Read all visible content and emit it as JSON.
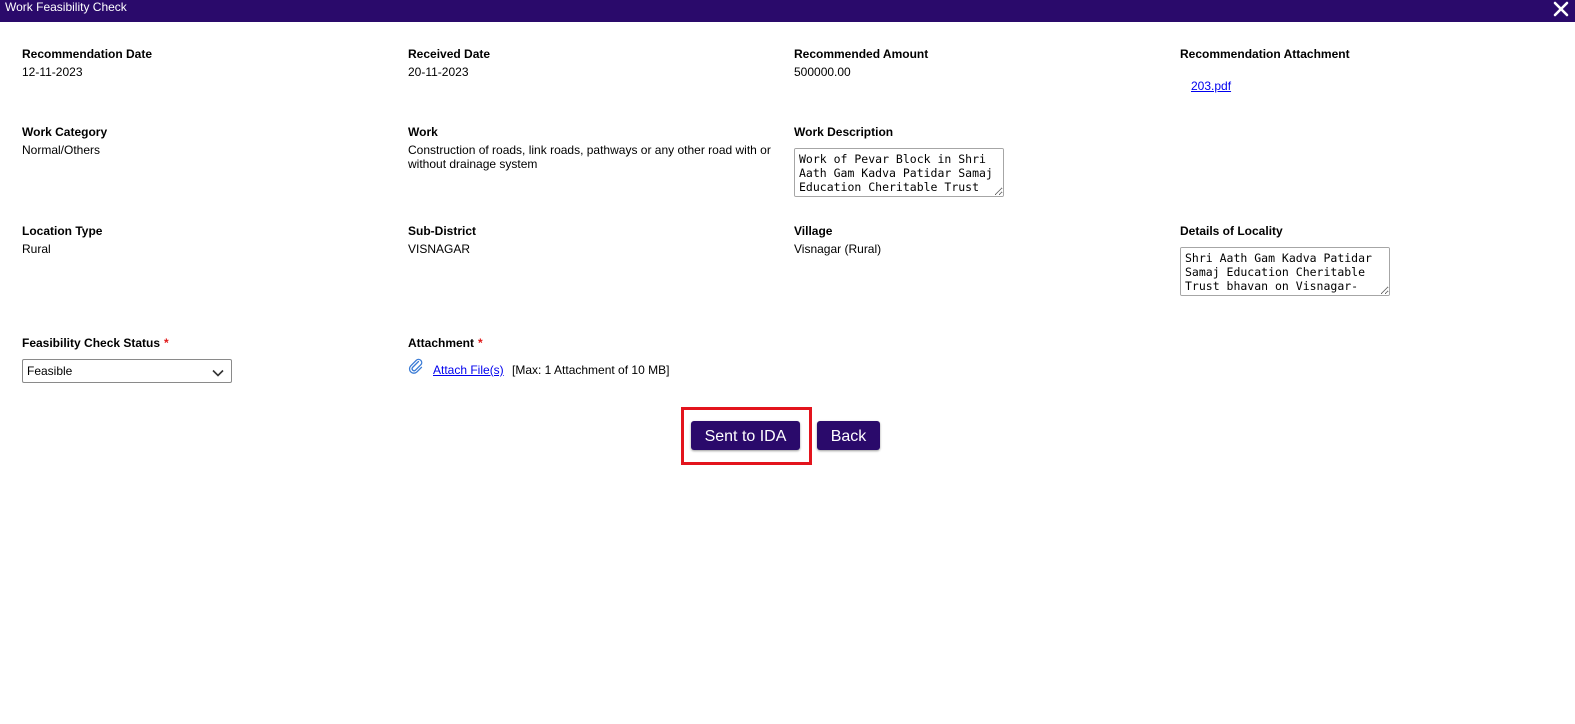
{
  "window": {
    "title": "Work Feasibility Check",
    "close_icon": "close-icon",
    "titlebar_color": "#2a0a6b"
  },
  "fields": {
    "recommendation_date": {
      "label": "Recommendation Date",
      "value": "12-11-2023"
    },
    "received_date": {
      "label": "Received Date",
      "value": "20-11-2023"
    },
    "recommended_amount": {
      "label": "Recommended Amount",
      "value": "500000.00"
    },
    "recommendation_attachment": {
      "label": "Recommendation Attachment",
      "link": "203.pdf"
    },
    "work_category": {
      "label": "Work Category",
      "value": "Normal/Others"
    },
    "work": {
      "label": "Work",
      "value": "Construction of roads, link roads, pathways or any other road with or without drainage system"
    },
    "work_description": {
      "label": "Work Description",
      "value": "Work of Pevar Block in Shri Aath Gam Kadva Patidar Samaj Education Cheritable Trust"
    },
    "location_type": {
      "label": "Location Type",
      "value": "Rural"
    },
    "sub_district": {
      "label": "Sub-District",
      "value": "VISNAGAR"
    },
    "village": {
      "label": "Village",
      "value": "Visnagar (Rural)"
    },
    "details_of_locality": {
      "label": "Details of Locality",
      "value": "Shri Aath Gam Kadva Patidar Samaj Education Cheritable Trust bhavan on Visnagar-"
    },
    "feasibility_check_status": {
      "label": "Feasibility Check Status",
      "required_mark": "*",
      "selected": "Feasible"
    },
    "attachment": {
      "label": "Attachment",
      "required_mark": "*",
      "link": "Attach File(s)",
      "note": "[Max: 1 Attachment of 10 MB]",
      "icon": "paperclip-icon"
    }
  },
  "buttons": {
    "sent_to_ida": "Sent to IDA",
    "back": "Back",
    "button_color": "#2a0a6b",
    "highlight_color": "#e3141d"
  }
}
